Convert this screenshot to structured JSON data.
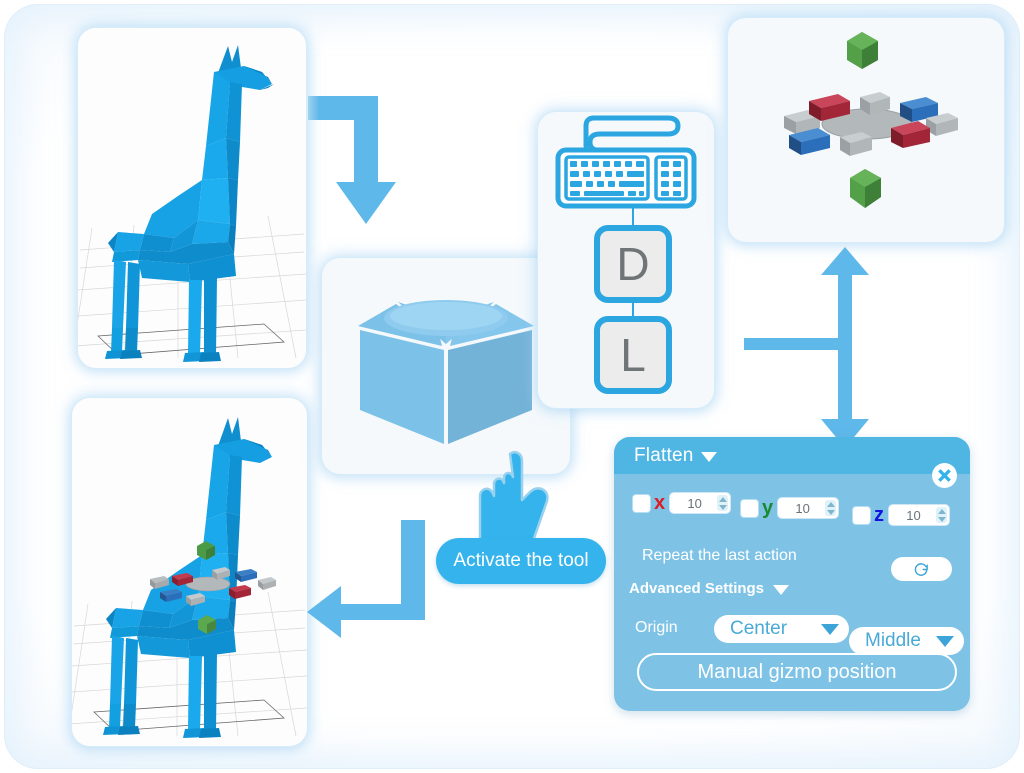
{
  "diagram": {
    "title": "Flatten tool workflow",
    "accent_color": "#35b3ec",
    "panel_header_color": "#4fb6e4",
    "panel_body_color": "#7ec3e6",
    "model_color": "#13a1e0"
  },
  "viewports": {
    "before": {
      "name": "Giraffe model before flatten",
      "model": "low-poly-giraffe",
      "has_gizmo": false
    },
    "after": {
      "name": "Giraffe model with gizmo",
      "model": "low-poly-giraffe",
      "has_gizmo": true
    }
  },
  "tool_icon": {
    "name": "flatten-tool-icon",
    "label": "Flatten box icon"
  },
  "shortcut": {
    "device_icon": "keyboard-icon",
    "keys": [
      {
        "label": "D"
      },
      {
        "label": "L"
      }
    ]
  },
  "gizmo_preview": {
    "name": "flatten-gizmo-preview",
    "handles": [
      {
        "axis": "y",
        "position": "top",
        "color": "#4a9a46"
      },
      {
        "axis": "y",
        "position": "bottom",
        "color": "#4a9a46"
      },
      {
        "axis": "x",
        "position": "left-far",
        "color": "#9ba2a6"
      },
      {
        "axis": "x",
        "position": "right-far",
        "color": "#9ba2a6"
      },
      {
        "axis": "x",
        "position": "left-near",
        "color": "#2b6fbb"
      },
      {
        "axis": "x",
        "position": "right-near",
        "color": "#2b6fbb"
      },
      {
        "axis": "z",
        "position": "back-left",
        "color": "#a32638"
      },
      {
        "axis": "z",
        "position": "front-right",
        "color": "#a32638"
      },
      {
        "axis": "z",
        "position": "back-center",
        "color": "#9ba2a6"
      },
      {
        "axis": "z",
        "position": "front-center",
        "color": "#9ba2a6"
      }
    ],
    "center_disc_color": "#b3b8bb"
  },
  "callout": {
    "cursor_icon": "pointing-hand-icon",
    "button_label": "Activate the tool"
  },
  "arrows": [
    {
      "name": "arrow-model-to-tool",
      "shape": "elbow-right-down"
    },
    {
      "name": "arrow-tool-to-result",
      "shape": "elbow-down-left"
    },
    {
      "name": "arrow-panel-to-gizmo",
      "shape": "t-double-vertical"
    }
  ],
  "flatten_panel": {
    "title": "Flatten",
    "title_caret_icon": "chevron-down-icon",
    "close_icon": "close-icon",
    "axes": [
      {
        "axis": "x",
        "label": "x",
        "color": "#e01b24",
        "checked": false,
        "value": "10"
      },
      {
        "axis": "y",
        "label": "y",
        "color": "#1a8a2e",
        "checked": false,
        "value": "10"
      },
      {
        "axis": "z",
        "label": "z",
        "color": "#1414e0",
        "checked": false,
        "value": "10"
      }
    ],
    "repeat_label": "Repeat the last action",
    "repeat_icon": "refresh-icon",
    "advanced_label": "Advanced Settings",
    "advanced_caret_icon": "chevron-down-icon",
    "origin_label": "Origin",
    "origin_horizontal": {
      "value": "Center",
      "caret_icon": "chevron-down-icon"
    },
    "origin_vertical": {
      "value": "Middle",
      "caret_icon": "chevron-down-icon"
    },
    "manual_button_label": "Manual gizmo position"
  }
}
